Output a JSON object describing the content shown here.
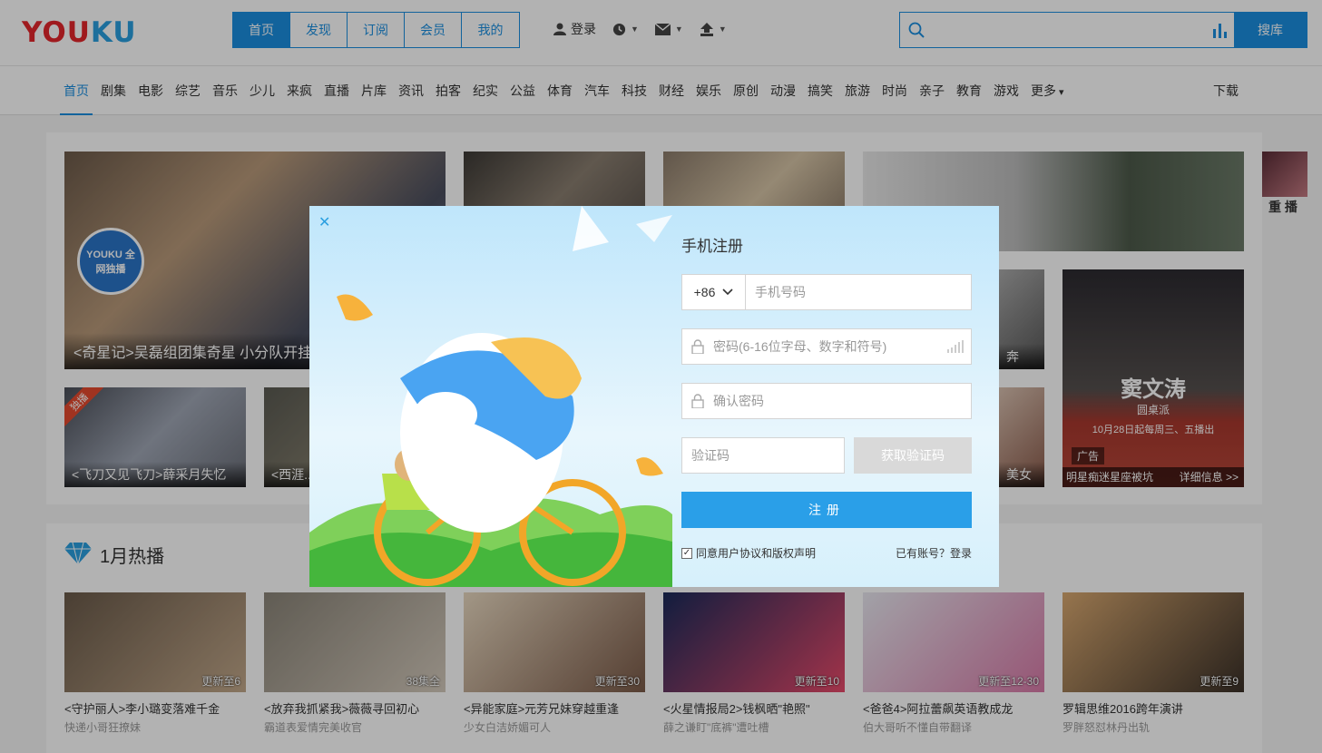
{
  "header": {
    "logo_a": "YOU",
    "logo_b": "KU",
    "nav": [
      "首页",
      "发现",
      "订阅",
      "会员",
      "我的"
    ],
    "login_label": "登录",
    "search_button": "搜库",
    "search_placeholder": ""
  },
  "categories": [
    "首页",
    "剧集",
    "电影",
    "综艺",
    "音乐",
    "少儿",
    "来疯",
    "直播",
    "片库",
    "资讯",
    "拍客",
    "纪实",
    "公益",
    "体育",
    "汽车",
    "科技",
    "财经",
    "娱乐",
    "原创",
    "动漫",
    "搞笑",
    "旅游",
    "时尚",
    "亲子",
    "教育",
    "游戏",
    "更多"
  ],
  "download_label": "下载",
  "featured": {
    "main_caption": "<奇星记>吴磊组团集奇星 小分队开挂",
    "main_badge": "YOUKU 全网独播",
    "side_caption_1": "<飞刀又见飞刀>薛采月失忆",
    "side_caption_2": "<西涯...",
    "side_label_replay": "重 播",
    "ad_tag": "广告",
    "ad_caption": "明星痴迷星座被坑",
    "ad_link": "详细信息 >>",
    "ad_title": "窦文涛",
    "ad_subtitle": "圆桌派",
    "ad_date": "10月28日起每周三、五播出",
    "exclusive_tag": "独播",
    "partial_text_1": "奔",
    "partial_text_2": "美女"
  },
  "hot_section": {
    "title": "1月热播",
    "items": [
      {
        "title": "<守护丽人>李小璐变落难千金",
        "sub": "快递小哥狂撩妹",
        "badge": "更新至6"
      },
      {
        "title": "<放弃我抓紧我>薇薇寻回初心",
        "sub": "霸道表爱情完美收官",
        "badge": "38集全"
      },
      {
        "title": "<异能家庭>元芳兄妹穿越重逢",
        "sub": "少女白洁娇媚可人",
        "badge": "更新至30"
      },
      {
        "title": "<火星情报局2>钱枫晒\"艳照\"",
        "sub": "薛之谦盯\"底裤\"遭吐槽",
        "badge": "更新至10"
      },
      {
        "title": "<爸爸4>阿拉蕾飙英语教成龙",
        "sub": "伯大哥听不懂自带翻译",
        "badge": "更新至12-30"
      },
      {
        "title": "罗辑思维2016跨年演讲",
        "sub": "罗胖怒怼林丹出轨",
        "badge": "更新至9"
      }
    ]
  },
  "modal": {
    "title": "手机注册",
    "country_code": "+86",
    "phone_placeholder": "手机号码",
    "password_placeholder": "密码(6-16位字母、数字和符号)",
    "confirm_placeholder": "确认密码",
    "code_placeholder": "验证码",
    "get_code_button": "获取验证码",
    "register_button": "注册",
    "agree_text": "同意用户协议和版权声明",
    "login_link": "已有账号？登录",
    "agree_checked": true
  },
  "colors": {
    "brand_blue": "#1a8fe0",
    "logo_red": "#e4262b",
    "register_blue": "#2a9fe8",
    "get_code_gray": "#d9d9d9"
  }
}
